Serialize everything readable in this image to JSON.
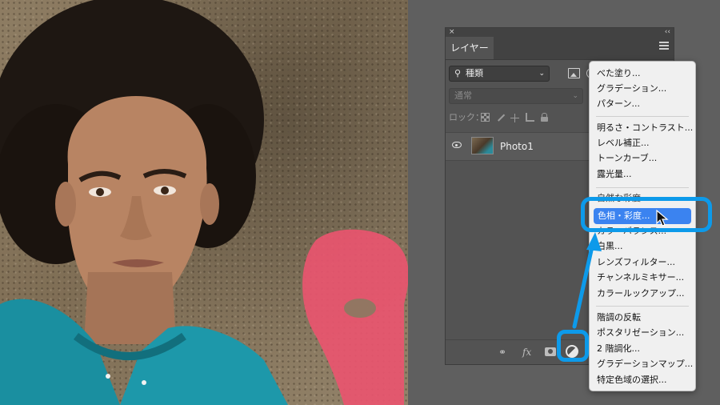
{
  "panel": {
    "close_glyph": "×",
    "collapse_glyph": "‹‹",
    "tab_label": "レイヤー",
    "filter": {
      "icon": "search-icon",
      "value": "種類"
    },
    "blend_mode": "通常",
    "lock_label": "ロック：",
    "layer": {
      "name": "Photo1"
    }
  },
  "footer": {
    "fx_label": "fx"
  },
  "menu": {
    "items": [
      "べた塗り...",
      "グラデーション...",
      "パターン...",
      "明るさ・コントラスト...",
      "レベル補正...",
      "トーンカーブ...",
      "露光量...",
      "自然な彩度...",
      "色相・彩度...",
      "カラーバランス...",
      "白黒...",
      "レンズフィルター...",
      "チャンネルミキサー...",
      "カラールックアップ...",
      "階調の反転",
      "ポスタリゼーション...",
      "2 階調化...",
      "グラデーションマップ...",
      "特定色域の選択..."
    ],
    "highlighted": "色相・彩度..."
  },
  "colors": {
    "highlight_ring": "#0d9aea",
    "menu_selection": "#3b83f0"
  }
}
